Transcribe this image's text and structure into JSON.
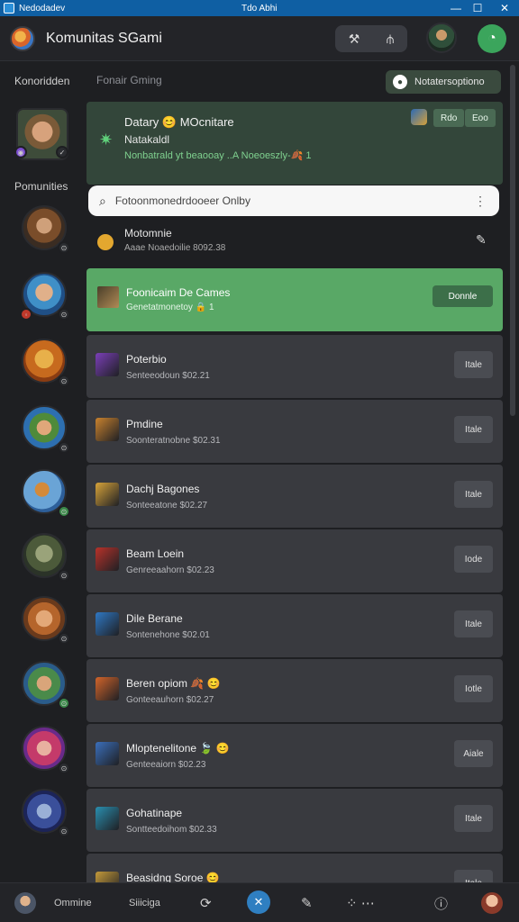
{
  "window": {
    "title_left": "Nedodadev",
    "title_center": "Tdo Abhi",
    "controls": [
      "—",
      "☐",
      "✕"
    ]
  },
  "header": {
    "app_title": "Komunitas SGami",
    "pill_icons": [
      "settings-tool-icon",
      "chart-icon"
    ]
  },
  "rail": {
    "heading_top": "Konoridden",
    "heading_mid": "Pomunities"
  },
  "main": {
    "breadcrumb": "Fonair Gming",
    "notify_button": "Notatersoptiono",
    "feature": {
      "line1": "Datary 😊 MOcnitare",
      "line2": "Natakaldl",
      "line3": "Nonbatrald yt beaooay ..A Noeoeszly-🍂 1",
      "tag1": "Rdo",
      "tag2": "Eoo"
    },
    "search": {
      "value": "Fotoonmonedrdooeer Onlby"
    },
    "mini": {
      "title": "Motomnie",
      "subtitle": "Aaae Noaedoilie 8092.38"
    },
    "active": {
      "title": "Foonicaim De Cames",
      "subtitle": "Genetatmonetoy 🔒 1",
      "button": "Donnle"
    },
    "games": [
      {
        "title": "Poterbio",
        "subtitle": "Senteeodoun $02.21",
        "button": "Itale",
        "color": "#7b3fb8"
      },
      {
        "title": "Pmdine",
        "subtitle": "Soonteratnobne $02.31",
        "button": "Itale",
        "color": "#c9822e"
      },
      {
        "title": "Dachj Bagones",
        "subtitle": "Sonteeatone $02.27",
        "button": "Itale",
        "color": "#d7a33a"
      },
      {
        "title": "Beam Loein",
        "subtitle": "Genreeaahorn $02.23",
        "button": "Iode",
        "color": "#b8322a"
      },
      {
        "title": "Dile Berane",
        "subtitle": "Sontenehone $02.01",
        "button": "Itale",
        "color": "#2f78c4"
      },
      {
        "title": "Beren opiom 🍂 😊",
        "subtitle": "Gonteeauhorn $02.27",
        "button": "Iotle",
        "color": "#d2642a"
      },
      {
        "title": "Mloptenelitone 🍃 😊",
        "subtitle": "Genteeaiorn $02.23",
        "button": "Aiale",
        "color": "#3b6fbb"
      },
      {
        "title": "Gohatinape",
        "subtitle": "Sontteedoihom $02.33",
        "button": "Itale",
        "color": "#2a8fb0"
      },
      {
        "title": "Beasidng Soroe 😊",
        "subtitle": "",
        "button": "Itale",
        "color": "#c49a3a"
      }
    ]
  },
  "bottombar": {
    "label1": "Ommine",
    "label2": "Siiiciga"
  },
  "colors": {
    "accent_green": "#59a866",
    "accent_blue": "#2f7fc1",
    "titlebar": "#0f5fa3"
  }
}
